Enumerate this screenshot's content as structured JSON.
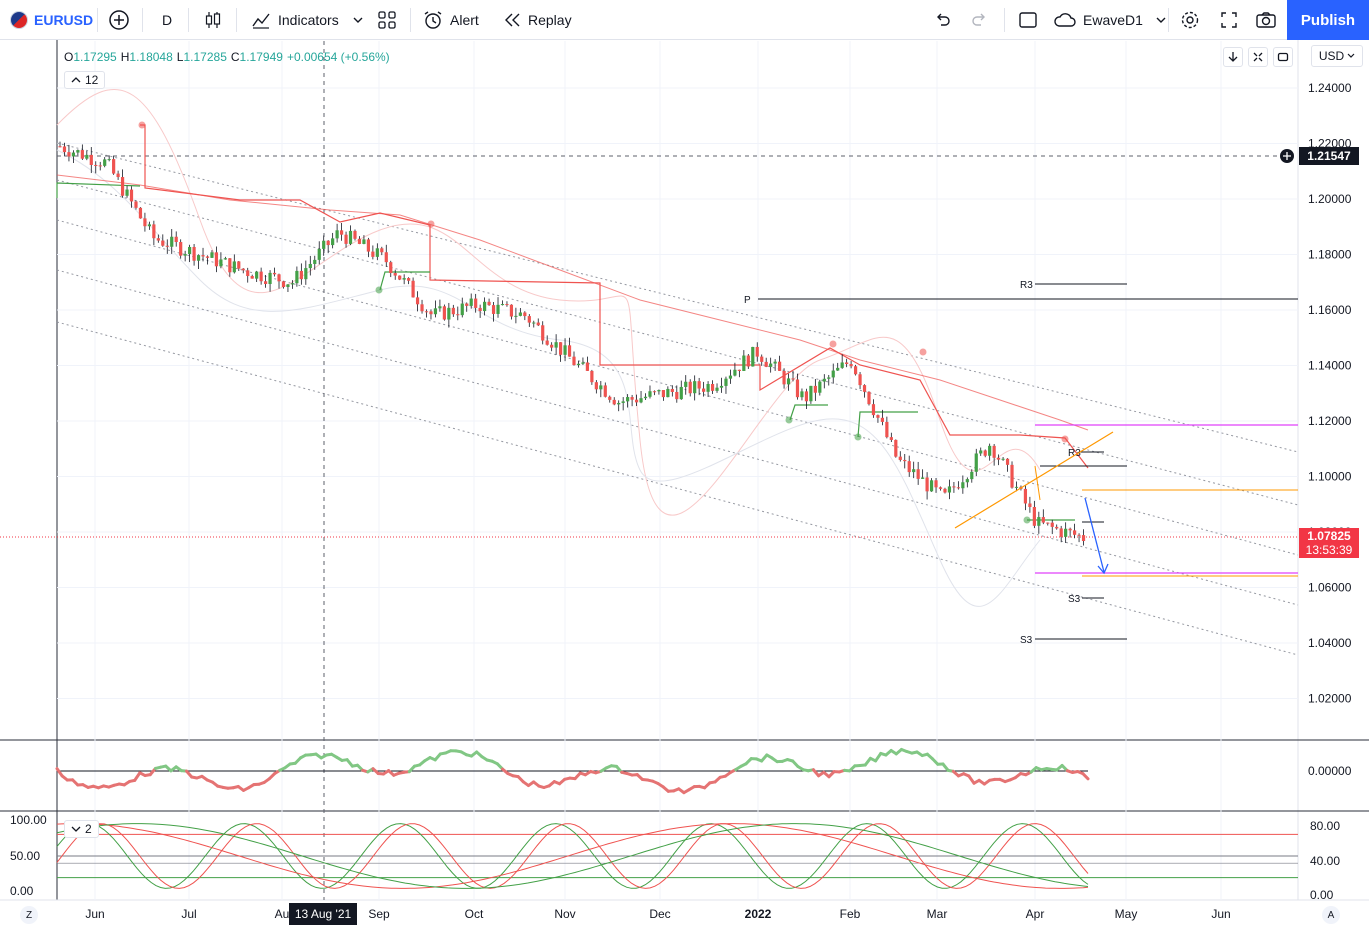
{
  "toolbar": {
    "symbol": "EURUSD",
    "interval": "D",
    "indicators_label": "Indicators",
    "alert_label": "Alert",
    "replay_label": "Replay",
    "layout_name": "EwaveD1",
    "publish_label": "Publish"
  },
  "legend": {
    "o_key": "O",
    "o_val": "1.17295",
    "h_key": "H",
    "h_val": "1.18048",
    "l_key": "L",
    "l_val": "1.17285",
    "c_key": "C",
    "c_val": "1.17949",
    "change": "+0.00654 (+0.56%)",
    "hidden_count": "12",
    "pane2_count": "2"
  },
  "currency": "USD",
  "price_axis": {
    "labels": [
      "1.24000",
      "1.22000",
      "1.20000",
      "1.18000",
      "1.16000",
      "1.14000",
      "1.12000",
      "1.10000",
      "1.08000",
      "1.06000",
      "1.04000",
      "1.02000"
    ],
    "crosshair_price": "1.21547",
    "current_price": "1.07825",
    "countdown": "13:53:39"
  },
  "osc_axis": {
    "labels": [
      "0.00000"
    ]
  },
  "stoch_axis": {
    "left_labels": [
      "100.00",
      "50.00",
      "0.00"
    ],
    "right_labels": [
      "80.00",
      "40.00",
      "0.00"
    ]
  },
  "time_axis": {
    "labels": [
      "Jun",
      "Jul",
      "Au",
      "Sep",
      "Oct",
      "Nov",
      "Dec",
      "2022",
      "Feb",
      "Mar",
      "Apr",
      "May",
      "Jun"
    ],
    "crosshair_date": "13 Aug '21"
  },
  "pivot_labels": {
    "p": "P",
    "r3_a": "R3",
    "r3_b": "R3",
    "s3_a": "S3",
    "s3_b": "S3"
  },
  "corner": {
    "left": "Z",
    "right": "A"
  },
  "colors": {
    "up": "#26a69a",
    "up_candle": "#43a047",
    "down": "#ef5350",
    "accent": "#2962ff",
    "magenta": "#e040fb",
    "orange": "#ff9800"
  },
  "chart_data": {
    "type": "candlestick",
    "symbol": "EURUSD",
    "ylim": [
      1.0,
      1.25
    ],
    "points": [
      {
        "x": "Jun",
        "y": 1.219
      },
      {
        "x": "Jun",
        "y": 1.213
      },
      {
        "x": "Jul",
        "y": 1.186
      },
      {
        "x": "Jul",
        "y": 1.18
      },
      {
        "x": "Au",
        "y": 1.174
      },
      {
        "x": "Au",
        "y": 1.17
      },
      {
        "x": "Sep",
        "y": 1.188
      },
      {
        "x": "Sep",
        "y": 1.178
      },
      {
        "x": "Oct",
        "y": 1.158
      },
      {
        "x": "Oct",
        "y": 1.162
      },
      {
        "x": "Nov",
        "y": 1.158
      },
      {
        "x": "Nov",
        "y": 1.142
      },
      {
        "x": "Dec",
        "y": 1.127
      },
      {
        "x": "Dec",
        "y": 1.13
      },
      {
        "x": "2022",
        "y": 1.133
      },
      {
        "x": "2022",
        "y": 1.145
      },
      {
        "x": "Feb",
        "y": 1.128
      },
      {
        "x": "Feb",
        "y": 1.142
      },
      {
        "x": "Mar",
        "y": 1.106
      },
      {
        "x": "Mar",
        "y": 1.092
      },
      {
        "x": "Apr",
        "y": 1.112
      },
      {
        "x": "Apr",
        "y": 1.083
      },
      {
        "x": "Apr",
        "y": 1.078
      }
    ]
  }
}
